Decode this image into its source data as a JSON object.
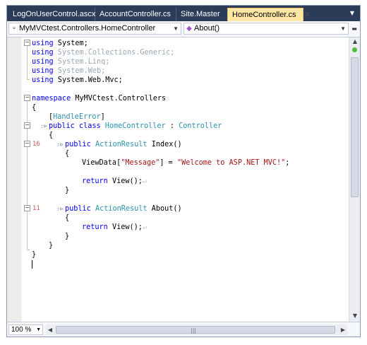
{
  "tabs": [
    {
      "label": "LogOnUserControl.ascx"
    },
    {
      "label": "AccountController.cs"
    },
    {
      "label": "Site.Master"
    },
    {
      "label": "HomeController.cs",
      "active": true,
      "close": "✕"
    }
  ],
  "navbar": {
    "type_combo": "MyMVCtest.Controllers.HomeController",
    "member_combo": "About()"
  },
  "code": {
    "l01": [
      "using",
      " System;"
    ],
    "l02": [
      "using",
      " System.Collections.Generic;"
    ],
    "l03": [
      "using",
      " System.Linq;"
    ],
    "l04": [
      "using",
      " System.Web;"
    ],
    "l05": [
      "using",
      " System.Web.Mvc;"
    ],
    "l07": [
      "namespace",
      " MyMVCtest.Controllers"
    ],
    "l08": "{",
    "l09": [
      "[",
      "HandleError",
      "]"
    ],
    "l10": [
      "public",
      "class",
      "HomeController",
      ":",
      "Controller"
    ],
    "l11": "{",
    "l12": [
      "public",
      "ActionResult",
      " Index()"
    ],
    "l13": "{",
    "l14": [
      "ViewData[",
      "\"Message\"",
      "] = ",
      "\"Welcome to ASP.NET MVC!\"",
      ";"
    ],
    "l16": [
      "return",
      " View();"
    ],
    "l17": "}",
    "l19": [
      "public",
      "ActionResult",
      " About()"
    ],
    "l20": "{",
    "l21": [
      "return",
      " View();"
    ],
    "l22": "}",
    "l23": "}",
    "l24": "}"
  },
  "reference_counts": {
    "index": "16",
    "about": "11"
  },
  "status": {
    "zoom": "100 %"
  },
  "colors": {
    "keyword": "#0000ff",
    "type": "#2b91af",
    "string": "#a31515",
    "tab_active": "#ffe8a6"
  }
}
